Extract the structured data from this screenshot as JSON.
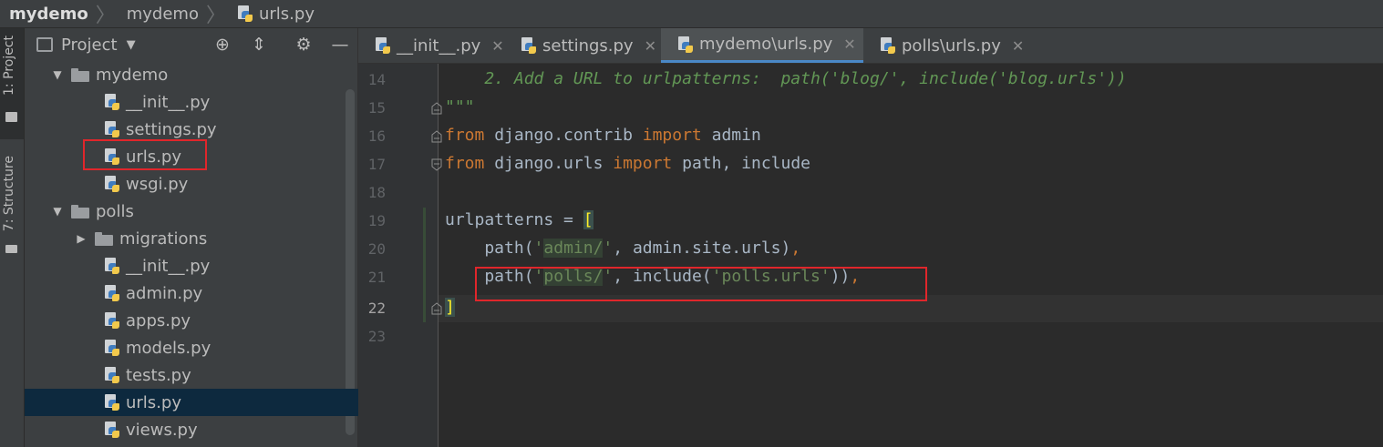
{
  "breadcrumb": [
    "mydemo",
    "mydemo",
    "urls.py"
  ],
  "side_tabs": {
    "project": "1: Project",
    "structure": "7: Structure"
  },
  "project_panel": {
    "title": "Project",
    "tree": [
      {
        "label": "mydemo",
        "type": "folder",
        "expanded": true
      },
      {
        "label": "__init__.py",
        "type": "py"
      },
      {
        "label": "settings.py",
        "type": "py"
      },
      {
        "label": "urls.py",
        "type": "py",
        "highlighted": true
      },
      {
        "label": "wsgi.py",
        "type": "py"
      },
      {
        "label": "polls",
        "type": "folder",
        "expanded": true
      },
      {
        "label": "migrations",
        "type": "folder",
        "expanded": false
      },
      {
        "label": "__init__.py",
        "type": "py"
      },
      {
        "label": "admin.py",
        "type": "py"
      },
      {
        "label": "apps.py",
        "type": "py"
      },
      {
        "label": "models.py",
        "type": "py"
      },
      {
        "label": "tests.py",
        "type": "py"
      },
      {
        "label": "urls.py",
        "type": "py",
        "selected": true
      },
      {
        "label": "views.py",
        "type": "py"
      }
    ]
  },
  "editor_tabs": [
    {
      "label": "__init__.py",
      "active": false
    },
    {
      "label": "settings.py",
      "active": false
    },
    {
      "label": "mydemo\\urls.py",
      "active": true
    },
    {
      "label": "polls\\urls.py",
      "active": false
    }
  ],
  "editor": {
    "line_numbers": [
      "14",
      "15",
      "16",
      "17",
      "18",
      "19",
      "20",
      "21",
      "22",
      "23"
    ],
    "current_line": "22",
    "lines": {
      "l14": "    2. Add a URL to urlpatterns:  path('blog/', include('blog.urls'))",
      "l15": "\"\"\"",
      "l16_kw1": "from",
      "l16_mod": " django.contrib ",
      "l16_kw2": "import",
      "l16_name": " admin",
      "l17_kw1": "from",
      "l17_mod": " django.urls ",
      "l17_kw2": "import",
      "l17_name": " path, include",
      "l19_a": "urlpatterns = ",
      "l19_b": "[",
      "l20_a": "    path(",
      "l20_s1": "'",
      "l20_s2": "admin/",
      "l20_s3": "'",
      "l20_b": ", admin.site.urls)",
      "l20_c": ",",
      "l21_a": "    path(",
      "l21_s1": "'",
      "l21_s2": "polls/",
      "l21_s3": "'",
      "l21_b": ", include(",
      "l21_s4": "'polls.urls'",
      "l21_c": "))",
      "l21_d": ",",
      "l22": "]"
    }
  }
}
